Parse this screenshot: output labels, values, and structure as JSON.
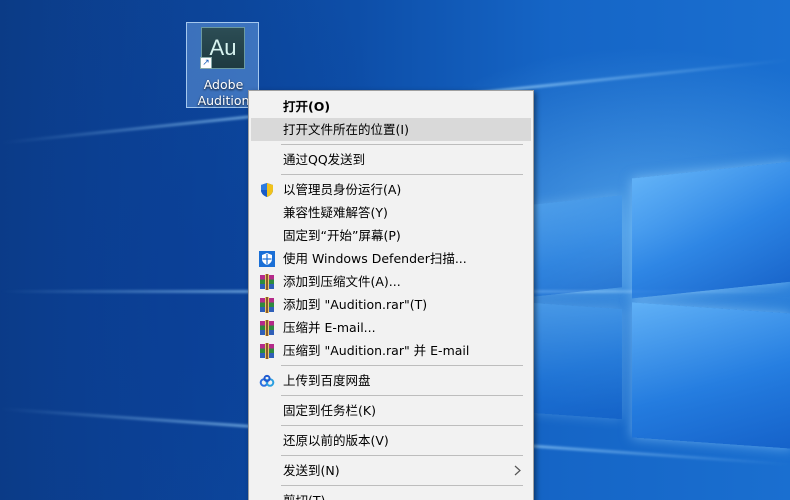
{
  "desktop": {
    "icon": {
      "logo_text": "Au",
      "label": "Adobe\nAudition",
      "shortcut_glyph": "↗"
    }
  },
  "menu": {
    "open": "打开(O)",
    "open_location": "打开文件所在的位置(I)",
    "send_qq": "通过QQ发送到",
    "run_admin": "以管理员身份运行(A)",
    "troubleshoot": "兼容性疑难解答(Y)",
    "pin_start": "固定到“开始”屏幕(P)",
    "defender": "使用 Windows Defender扫描...",
    "add_archive": "添加到压缩文件(A)...",
    "add_rar": "添加到 \"Audition.rar\"(T)",
    "compress_email": "压缩并 E-mail...",
    "compress_rar_email": "压缩到 \"Audition.rar\" 并 E-mail",
    "upload_baidu": "上传到百度网盘",
    "pin_taskbar": "固定到任务栏(K)",
    "restore_versions": "还原以前的版本(V)",
    "send_to": "发送到(N)",
    "cut": "剪切(T)"
  },
  "colors": {
    "menu_bg": "#f2f2f2",
    "hover_bg": "#d9d9d9",
    "desktop_blue": "#0d4ea8"
  }
}
